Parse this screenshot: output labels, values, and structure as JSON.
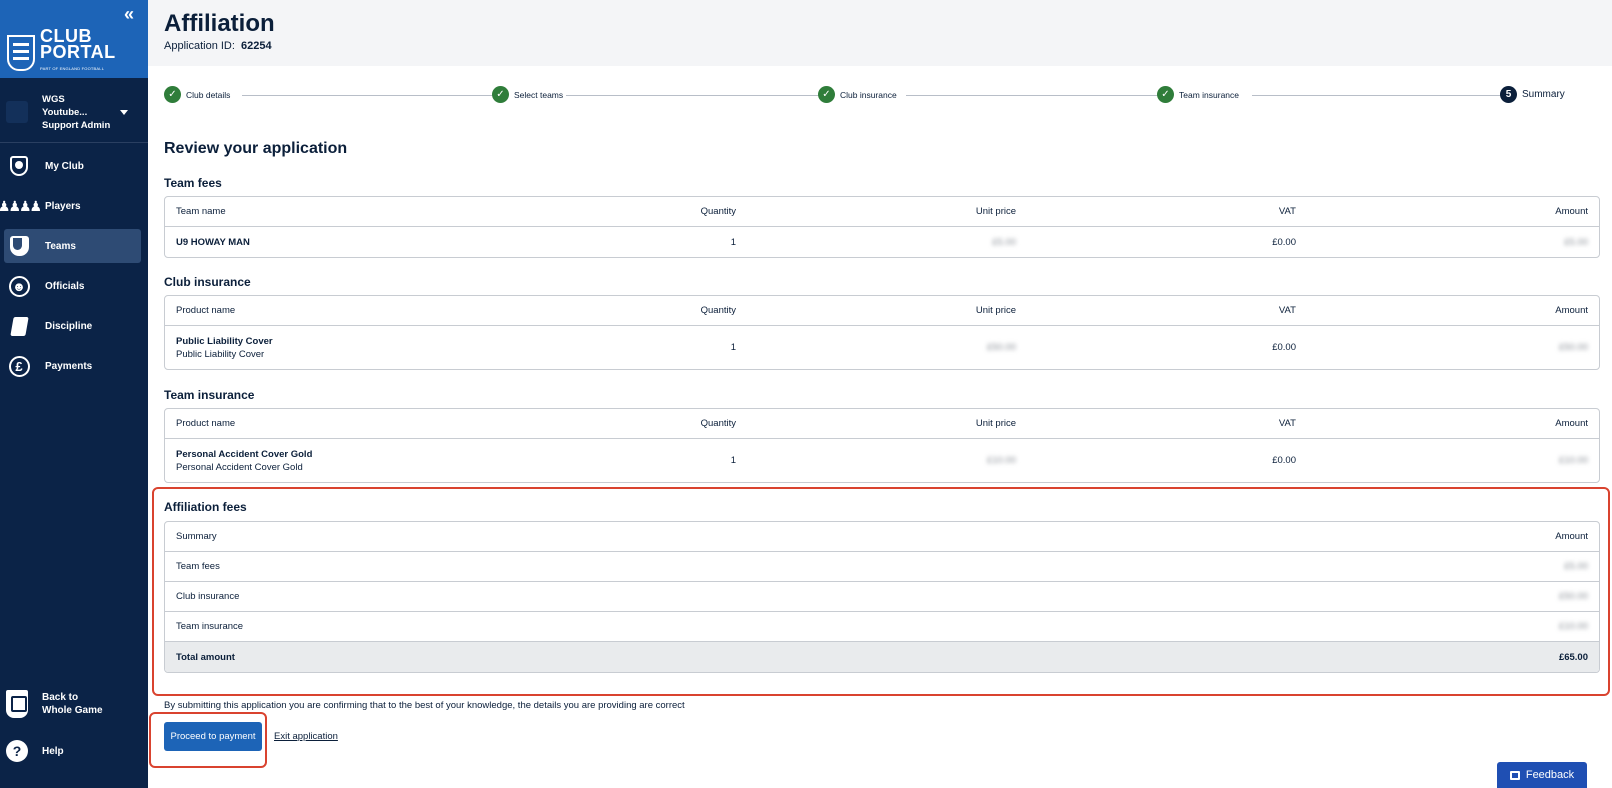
{
  "sidebar": {
    "logo": {
      "line1": "CLUB",
      "line2": "PORTAL",
      "sub": "PART OF ENGLAND FOOTBALL"
    },
    "account": {
      "name": "WGS Youtube...",
      "role": "Support Admin"
    },
    "items": [
      {
        "label": "My Club",
        "icon": "club-shield-icon"
      },
      {
        "label": "Players",
        "icon": "players-icon"
      },
      {
        "label": "Teams",
        "icon": "team-shield-icon",
        "active": true
      },
      {
        "label": "Officials",
        "icon": "officials-icon"
      },
      {
        "label": "Discipline",
        "icon": "card-icon"
      },
      {
        "label": "Payments",
        "icon": "pound-icon"
      }
    ],
    "back_label": "Back to Whole Game",
    "help_label": "Help"
  },
  "header": {
    "title": "Affiliation",
    "app_id_label": "Application ID:",
    "app_id": "62254"
  },
  "stepper": {
    "steps": [
      {
        "label": "Club details",
        "status": "complete"
      },
      {
        "label": "Select teams",
        "status": "complete"
      },
      {
        "label": "Club insurance",
        "status": "complete"
      },
      {
        "label": "Team insurance",
        "status": "complete"
      },
      {
        "label": "Summary",
        "status": "current",
        "number": "5"
      }
    ]
  },
  "review_title": "Review your application",
  "team_fees": {
    "title": "Team fees",
    "headers": [
      "Team name",
      "Quantity",
      "Unit price",
      "VAT",
      "Amount"
    ],
    "row": {
      "name": "U9 HOWAY MAN",
      "quantity": "1",
      "unit_price": "£5.00",
      "vat": "£0.00",
      "amount": "£5.00"
    }
  },
  "club_insurance": {
    "title": "Club insurance",
    "headers": [
      "Product name",
      "Quantity",
      "Unit price",
      "VAT",
      "Amount"
    ],
    "row": {
      "name": "Public Liability Cover",
      "sub": "Public Liability Cover",
      "quantity": "1",
      "unit_price": "£50.00",
      "vat": "£0.00",
      "amount": "£50.00"
    }
  },
  "team_insurance": {
    "title": "Team insurance",
    "headers": [
      "Product name",
      "Quantity",
      "Unit price",
      "VAT",
      "Amount"
    ],
    "row": {
      "name": "Personal Accident Cover Gold",
      "sub": "Personal Accident Cover Gold",
      "quantity": "1",
      "unit_price": "£10.00",
      "vat": "£0.00",
      "amount": "£10.00"
    }
  },
  "affiliation_fees": {
    "title": "Affiliation fees",
    "headers": [
      "Summary",
      "Amount"
    ],
    "rows": [
      {
        "label": "Team fees",
        "amount": "£5.00"
      },
      {
        "label": "Club insurance",
        "amount": "£50.00"
      },
      {
        "label": "Team insurance",
        "amount": "£10.00"
      }
    ],
    "total_label": "Total amount",
    "total": "£65.00"
  },
  "confirm_text": "By submitting this application you are confirming that to the best of your knowledge, the details you are providing are correct",
  "actions": {
    "proceed": "Proceed to payment",
    "exit": "Exit application"
  },
  "feedback_label": "Feedback",
  "colors": {
    "sidebar": "#0b2347",
    "brand_blue": "#1d64b7",
    "complete_green": "#2f7d3a",
    "highlight_red": "#d9432f"
  }
}
